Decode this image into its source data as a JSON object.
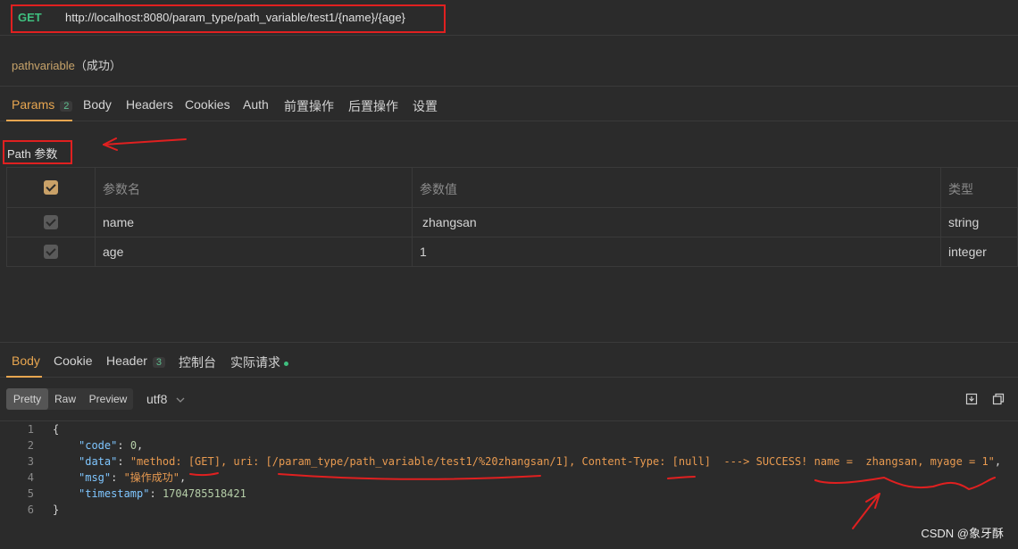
{
  "request": {
    "method": "GET",
    "url": "http://localhost:8080/param_type/path_variable/test1/{name}/{age}",
    "name": "pathvariable",
    "status": "（成功）"
  },
  "request_tabs": [
    {
      "label": "Params",
      "badge": "2"
    },
    {
      "label": "Body"
    },
    {
      "label": "Headers"
    },
    {
      "label": "Cookies"
    },
    {
      "label": "Auth"
    },
    {
      "label": "前置操作"
    },
    {
      "label": "后置操作"
    },
    {
      "label": "设置"
    }
  ],
  "params": {
    "section_title": "Path 参数",
    "headers": [
      "参数名",
      "参数值",
      "类型"
    ],
    "rows": [
      {
        "name": "name",
        "value": "zhangsan",
        "type": "string"
      },
      {
        "name": "age",
        "value": "1",
        "type": "integer"
      }
    ]
  },
  "response_tabs": [
    {
      "label": "Body"
    },
    {
      "label": "Cookie"
    },
    {
      "label": "Header",
      "badge": "3"
    },
    {
      "label": "控制台"
    },
    {
      "label": "实际请求"
    }
  ],
  "view_modes": [
    "Pretty",
    "Raw",
    "Preview"
  ],
  "encoding": "utf8",
  "code": {
    "line_numbers": [
      "1",
      "2",
      "3",
      "4",
      "5",
      "6"
    ],
    "open_brace": "{",
    "close_brace": "}",
    "code_key": "\"code\"",
    "code_value": "0",
    "data_key": "\"data\"",
    "data_value": "\"method: [GET], uri: [/param_type/path_variable/test1/%20zhangsan/1], Content-Type: [null]  ---> SUCCESS! name =  zhangsan, myage = 1\"",
    "msg_key": "\"msg\"",
    "msg_value": "\"操作成功\"",
    "timestamp_key": "\"timestamp\"",
    "timestamp_value": "1704785518421"
  },
  "watermark": "CSDN @象牙酥",
  "colors": {
    "accent": "#e8a650",
    "method": "#3fbf7f",
    "annotation": "#e02020"
  }
}
